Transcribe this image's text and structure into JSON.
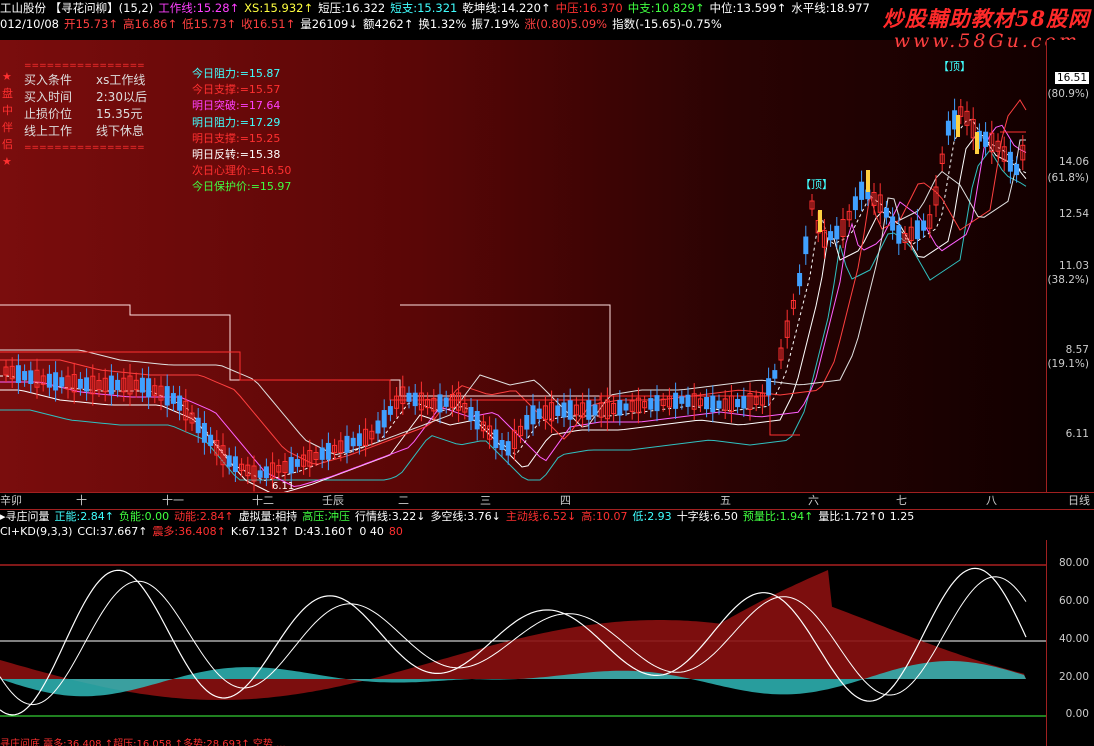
{
  "header": {
    "row1": [
      {
        "t": "工山股份 【寻花问柳】(15,2)",
        "c": "#ffffff"
      },
      {
        "t": "工作线:15.28↑",
        "c": "#ff40ff"
      },
      {
        "t": "XS:15.932↑",
        "c": "#ffff40"
      },
      {
        "t": "短压:16.322",
        "c": "#ffffff"
      },
      {
        "t": "短支:15.321",
        "c": "#40ffff"
      },
      {
        "t": "乾坤线:14.220↑",
        "c": "#ffffff"
      },
      {
        "t": "中压:16.370",
        "c": "#ff3030"
      },
      {
        "t": "中支:10.829↑",
        "c": "#40ff40"
      },
      {
        "t": "中位:13.599↑",
        "c": "#ffffff"
      },
      {
        "t": "水平线:18.977",
        "c": "#ffffff"
      }
    ],
    "row2": [
      {
        "t": "012/10/08",
        "c": "#ffffff"
      },
      {
        "t": "开15.73↑",
        "c": "#ff4040"
      },
      {
        "t": "高16.86↑",
        "c": "#ff4040"
      },
      {
        "t": "低15.73↑",
        "c": "#ff4040"
      },
      {
        "t": "收16.51↑",
        "c": "#ff4040"
      },
      {
        "t": "量26109↓",
        "c": "#ffffff"
      },
      {
        "t": "额4262↑",
        "c": "#ffffff"
      },
      {
        "t": "换1.32%",
        "c": "#ffffff"
      },
      {
        "t": "振7.19%",
        "c": "#ffffff"
      },
      {
        "t": "涨(0.80)5.09%",
        "c": "#ff4040"
      },
      {
        "t": "指数(-15.65)-0.75%",
        "c": "#ffffff"
      }
    ]
  },
  "watermark": {
    "line1": "炒股輔助教材58股网",
    "line2": "www.58Gu.com"
  },
  "infobox": {
    "stars": [
      "★",
      "盘",
      "中",
      "伴",
      "侣",
      "★"
    ],
    "divider": "================",
    "rows": [
      {
        "k": "买入条件",
        "v": "xs工作线"
      },
      {
        "k": "买入时间",
        "v": "2:30以后"
      },
      {
        "k": "止损价位",
        "v": "15.35元"
      },
      {
        "k": "线上工作",
        "v": "线下休息"
      }
    ]
  },
  "levels": [
    {
      "t": "今日阻力:=15.87",
      "c": "#40ffff"
    },
    {
      "t": "今日支撑:=15.57",
      "c": "#ff3030"
    },
    {
      "t": "明日突破:=17.64",
      "c": "#ff40ff"
    },
    {
      "t": "明日阻力:=17.29",
      "c": "#40ffff"
    },
    {
      "t": "明日支撑:=15.25",
      "c": "#ff3030"
    },
    {
      "t": "明日反转:=15.38",
      "c": "#ffffff"
    },
    {
      "t": "次日心理价:=16.50",
      "c": "#ff3030"
    },
    {
      "t": "今日保护价:=15.97",
      "c": "#40ff40"
    }
  ],
  "tags": {
    "top1": "【顶】",
    "top2": "【顶】",
    "low": "6.11"
  },
  "price_axis": {
    "labels": [
      {
        "v": "16.51",
        "hl": true
      },
      {
        "p": "(80.9%)"
      },
      {
        "v": "14.06"
      },
      {
        "p": "(61.8%)"
      },
      {
        "v": "12.54"
      },
      {
        "v": "11.03"
      },
      {
        "p": "(38.2%)"
      },
      {
        "v": "8.57"
      },
      {
        "p": "(19.1%)"
      },
      {
        "v": "6.11"
      }
    ]
  },
  "xaxis": {
    "labels": [
      "辛卯",
      "十",
      "十一",
      "十二",
      "壬辰",
      "二",
      "三",
      "四",
      "五",
      "六",
      "七",
      "八"
    ],
    "period": "日线"
  },
  "indicator1": [
    {
      "t": "▸寻庄问量",
      "c": "#ffffff"
    },
    {
      "t": "正能:2.84↑",
      "c": "#40ffff"
    },
    {
      "t": "负能:0.00",
      "c": "#40ff40"
    },
    {
      "t": "动能:2.84↑",
      "c": "#ff3030"
    },
    {
      "t": "虚拟量:相持",
      "c": "#ffffff"
    },
    {
      "t": "高压:冲压",
      "c": "#40ff40"
    },
    {
      "t": "行情线:3.22↓",
      "c": "#ffffff"
    },
    {
      "t": "多空线:3.76↓",
      "c": "#ffffff"
    },
    {
      "t": "主动线:6.52↓",
      "c": "#ff3030"
    },
    {
      "t": "高:10.07",
      "c": "#ff3030"
    },
    {
      "t": "低:2.93",
      "c": "#40ffff"
    },
    {
      "t": "十字线:6.50",
      "c": "#ffffff"
    },
    {
      "t": "预量比:1.94↑",
      "c": "#40ff40"
    },
    {
      "t": "量比:1.72↑0",
      "c": "#ffffff"
    },
    {
      "t": "1.25",
      "c": "#ffffff"
    }
  ],
  "indicator2": [
    {
      "t": "CI+KD(9,3,3)",
      "c": "#ffffff"
    },
    {
      "t": "CCI:37.667↑",
      "c": "#ffffff"
    },
    {
      "t": "震多:36.408↑",
      "c": "#ff3030"
    },
    {
      "t": "K:67.132↑",
      "c": "#ffffff"
    },
    {
      "t": "D:43.160↑",
      "c": "#ffffff"
    },
    {
      "t": "0 40",
      "c": "#ffffff"
    },
    {
      "t": "80",
      "c": "#ff3030"
    }
  ],
  "sub_axis": [
    "80.00",
    "60.00",
    "40.00",
    "20.00",
    "0.00"
  ],
  "bottom_text": "寻庄问底 震多:36.408 ↑超压:16.058 ↑多势:28.693↑ 空势 ..."
}
